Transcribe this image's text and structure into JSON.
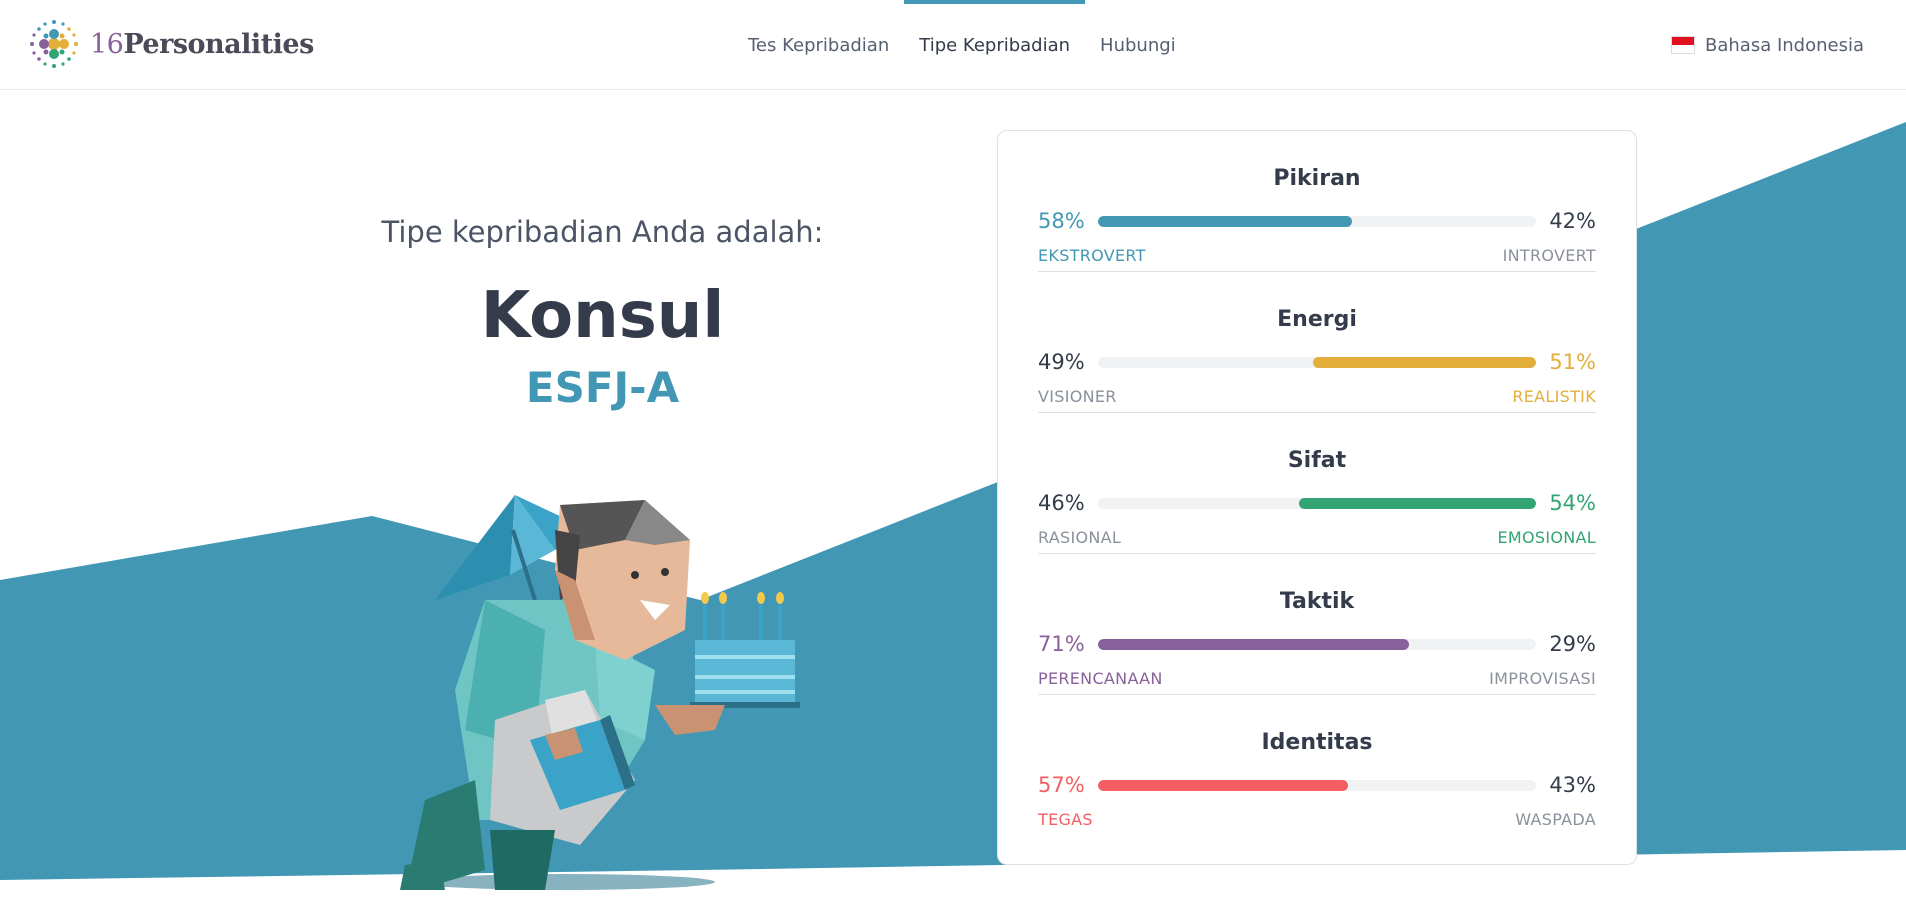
{
  "header": {
    "logo_num": "16",
    "logo_word": "Personalities",
    "nav": [
      {
        "label": "Tes Kepribadian",
        "active": false
      },
      {
        "label": "Tipe Kepribadian",
        "active": true
      },
      {
        "label": "Hubungi",
        "active": false
      }
    ],
    "language": "Bahasa Indonesia"
  },
  "hero": {
    "subtitle": "Tipe kepribadian Anda adalah:",
    "type_name": "Konsul",
    "type_code": "ESFJ-A"
  },
  "traits": [
    {
      "title": "Pikiran",
      "left_pct": "58%",
      "right_pct": "42%",
      "left_label": "EKSTROVERT",
      "right_label": "INTROVERT",
      "dominant": "left",
      "value": 58,
      "color": "#4298b4"
    },
    {
      "title": "Energi",
      "left_pct": "49%",
      "right_pct": "51%",
      "left_label": "VISIONER",
      "right_label": "REALISTIK",
      "dominant": "right",
      "value": 51,
      "color": "#e4ae3a"
    },
    {
      "title": "Sifat",
      "left_pct": "46%",
      "right_pct": "54%",
      "left_label": "RASIONAL",
      "right_label": "EMOSIONAL",
      "dominant": "right",
      "value": 54,
      "color": "#33a474"
    },
    {
      "title": "Taktik",
      "left_pct": "71%",
      "right_pct": "29%",
      "left_label": "PERENCANAAN",
      "right_label": "IMPROVISASI",
      "dominant": "left",
      "value": 71,
      "color": "#88619a"
    },
    {
      "title": "Identitas",
      "left_pct": "57%",
      "right_pct": "43%",
      "left_label": "TEGAS",
      "right_label": "WASPADA",
      "dominant": "left",
      "value": 57,
      "color": "#f25e62"
    }
  ],
  "colors": {
    "accent": "#4298b4",
    "background_shape": "#4298b4",
    "text_dark": "#343c4b"
  }
}
